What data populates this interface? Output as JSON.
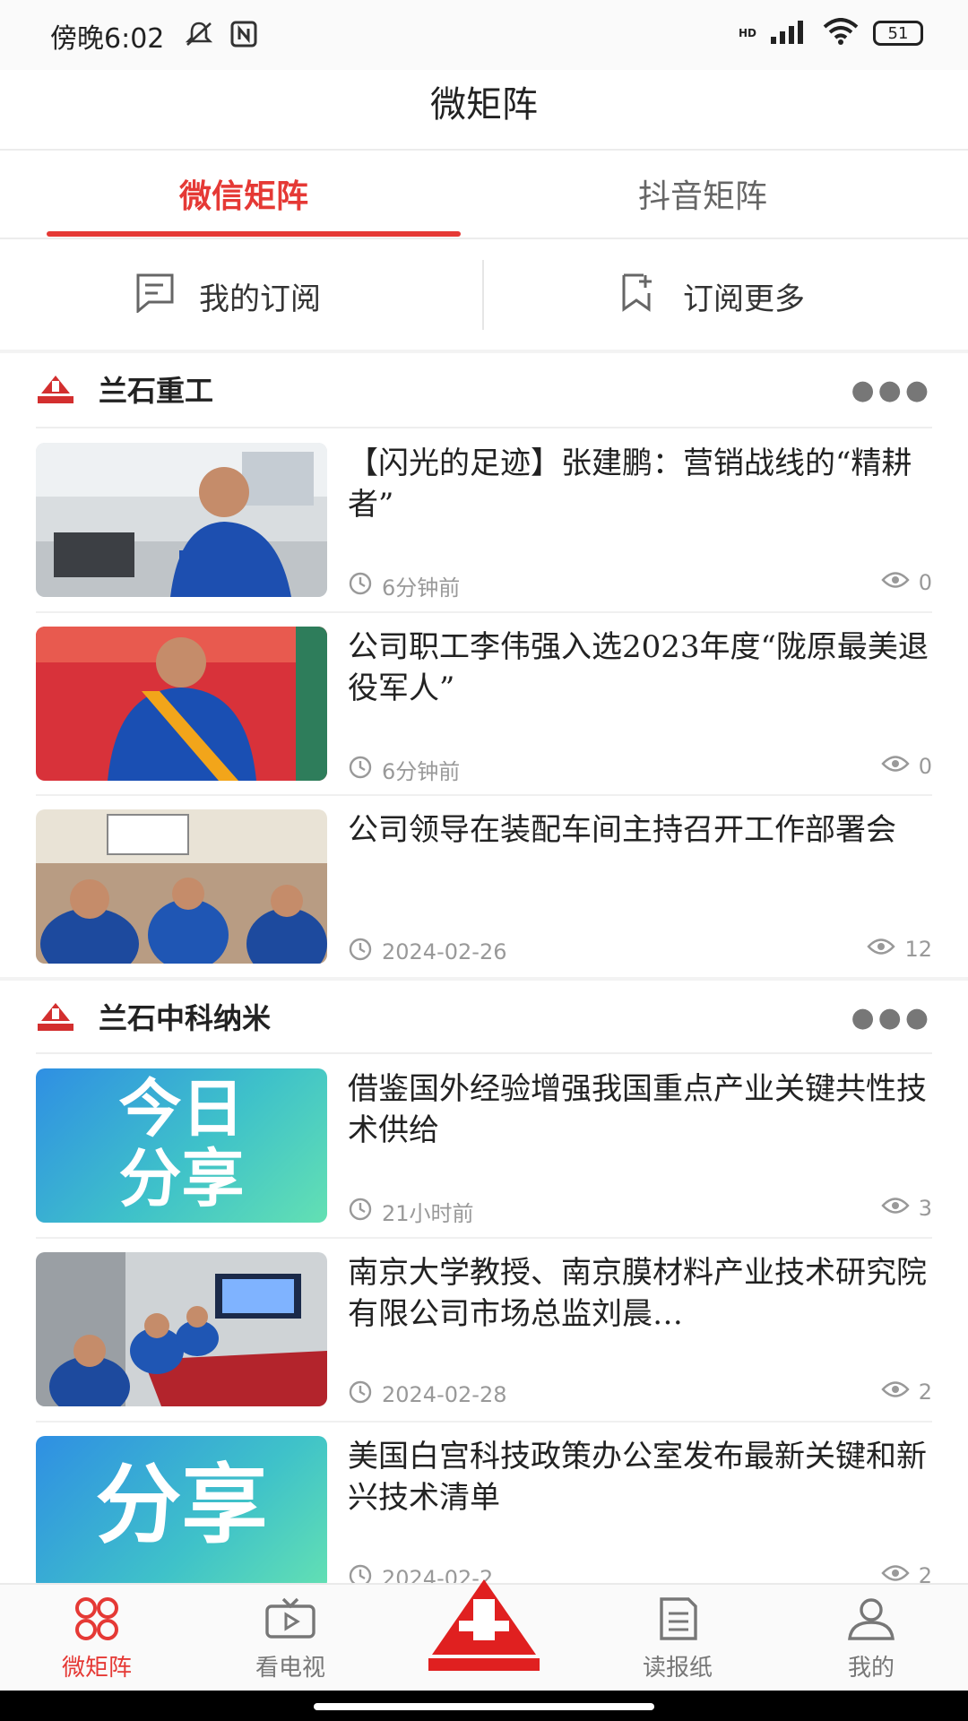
{
  "status_bar": {
    "time": "傍晚6:02",
    "battery": "51",
    "network": "HD"
  },
  "header": {
    "title": "微矩阵"
  },
  "tabs": [
    {
      "label": "微信矩阵",
      "active": true
    },
    {
      "label": "抖音矩阵",
      "active": false
    }
  ],
  "subscriptions": {
    "mine_label": "我的订阅",
    "more_label": "订阅更多"
  },
  "sections": [
    {
      "name": "兰石重工",
      "logo_text": "兰石重工",
      "articles": [
        {
          "title": "【闪光的足迹】张建鹏：营销战线的“精耕者”",
          "time": "6分钟前",
          "views": "0"
        },
        {
          "title": "公司职工李伟强入选2023年度“陇原最美退役军人”",
          "time": "6分钟前",
          "views": "0"
        },
        {
          "title": "公司领导在装配车间主持召开工作部署会",
          "time": "2024-02-26",
          "views": "12"
        }
      ]
    },
    {
      "name": "兰石中科纳米",
      "logo_text": "兰石中科",
      "articles": [
        {
          "title": "借鉴国外经验增强我国重点产业关键共性技术供给",
          "time": "21小时前",
          "views": "3",
          "thumb_text": [
            "今日",
            "分享"
          ]
        },
        {
          "title": "南京大学教授、南京膜材料产业技术研究院有限公司市场总监刘晨…",
          "time": "2024-02-28",
          "views": "2"
        },
        {
          "title": "美国白宫科技政策办公室发布最新关键和新兴技术清单",
          "time": "2024-02-2",
          "views": "2",
          "thumb_text": [
            "分享"
          ]
        }
      ]
    }
  ],
  "bottom_nav": [
    {
      "label": "微矩阵",
      "icon": "grid-icon",
      "active": true
    },
    {
      "label": "看电视",
      "icon": "tv-icon",
      "active": false
    },
    {
      "label": "",
      "icon": "lanshi-logo-icon",
      "active": false
    },
    {
      "label": "读报纸",
      "icon": "newspaper-icon",
      "active": false
    },
    {
      "label": "我的",
      "icon": "user-icon",
      "active": false
    }
  ],
  "colors": {
    "accent": "#e53935",
    "muted": "#999999"
  }
}
